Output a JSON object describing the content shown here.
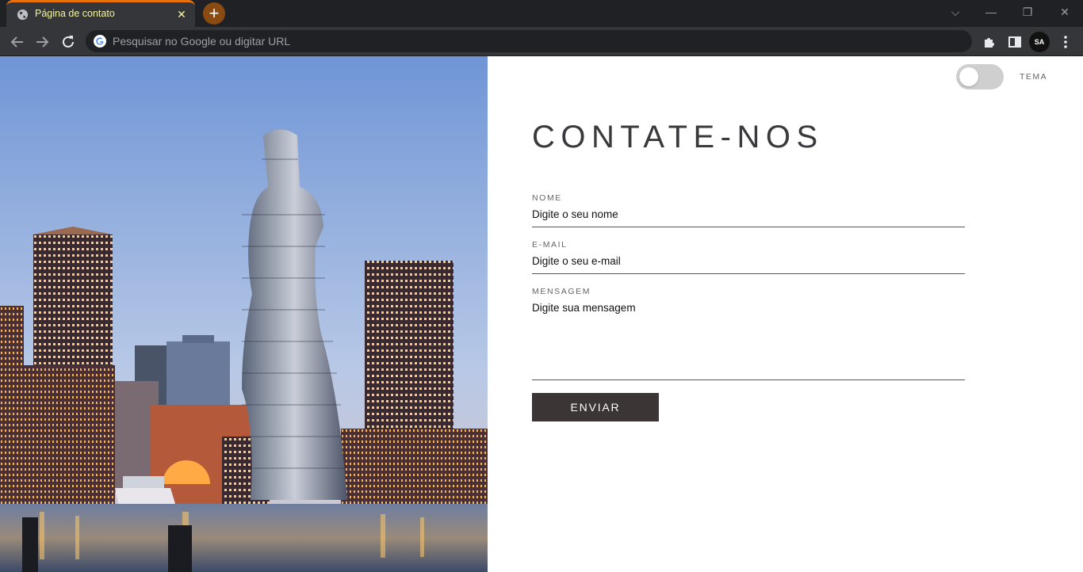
{
  "browser": {
    "tab": {
      "title": "Página de contato",
      "close_glyph": "✕"
    },
    "new_tab_glyph": "+",
    "window_controls": {
      "collapse": "⌵",
      "minimize": "—",
      "restore": "❐",
      "close": "✕"
    },
    "omnibox": {
      "placeholder": "Pesquisar no Google ou digitar URL"
    },
    "profile_initials": "SA",
    "icons": [
      "back-icon",
      "forward-icon",
      "reload-icon",
      "google-icon",
      "extensions-icon",
      "side-panel-icon",
      "menu-icon"
    ]
  },
  "theme_toggle": {
    "label": "TEMA",
    "on": false
  },
  "contact": {
    "title": "CONTATE-NOS",
    "fields": [
      {
        "label": "NOME",
        "placeholder": "Digite o seu nome"
      },
      {
        "label": "E-MAIL",
        "placeholder": "Digite o seu e-mail"
      },
      {
        "label": "MENSAGEM",
        "placeholder": "Digite sua mensagem"
      }
    ],
    "submit_label": "ENVIAR"
  },
  "colors": {
    "tab_accent": "#e8710a",
    "tab_text": "#f5f5a0",
    "button_bg": "#3b3535",
    "title_text": "#3a3a3e"
  }
}
